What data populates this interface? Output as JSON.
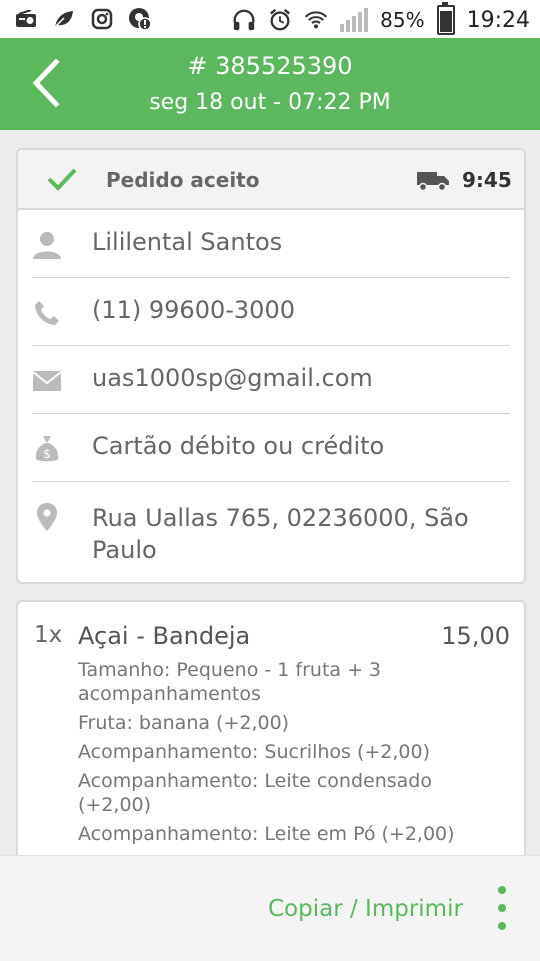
{
  "status_bar": {
    "battery": "85%",
    "time": "19:24"
  },
  "header": {
    "order_number": "# 385525390",
    "datetime": "seg 18 out - 07:22 PM"
  },
  "order_status": {
    "label": "Pedido aceito",
    "eta": "9:45",
    "accent": "#5cb85c"
  },
  "customer": {
    "name": "Lililental Santos",
    "phone": "(11) 99600-3000",
    "email": "uas1000sp@gmail.com",
    "payment": "Cartão débito ou crédito",
    "address": "Rua Uallas 765,  02236000, São Paulo"
  },
  "items": [
    {
      "qty": "1x",
      "name": "Açai - Bandeja",
      "price": "15,00",
      "options": [
        "Tamanho: Pequeno - 1 fruta + 3 acompanhamentos",
        "Fruta: banana (+2,00)",
        "Acompanhamento: Sucrilhos (+2,00)",
        "Acompanhamento: Leite condensado (+2,00)",
        "Acompanhamento: Leite em Pó (+2,00)"
      ]
    }
  ],
  "bottom_bar": {
    "copy_print_label": "Copiar / Imprimir"
  },
  "icons": {
    "back": "back-arrow-icon",
    "check": "check-icon",
    "truck": "truck-icon",
    "person": "person-icon",
    "phone": "phone-icon",
    "email": "email-icon",
    "money": "money-bag-icon",
    "location": "location-pin-icon",
    "more": "more-vert-icon"
  }
}
